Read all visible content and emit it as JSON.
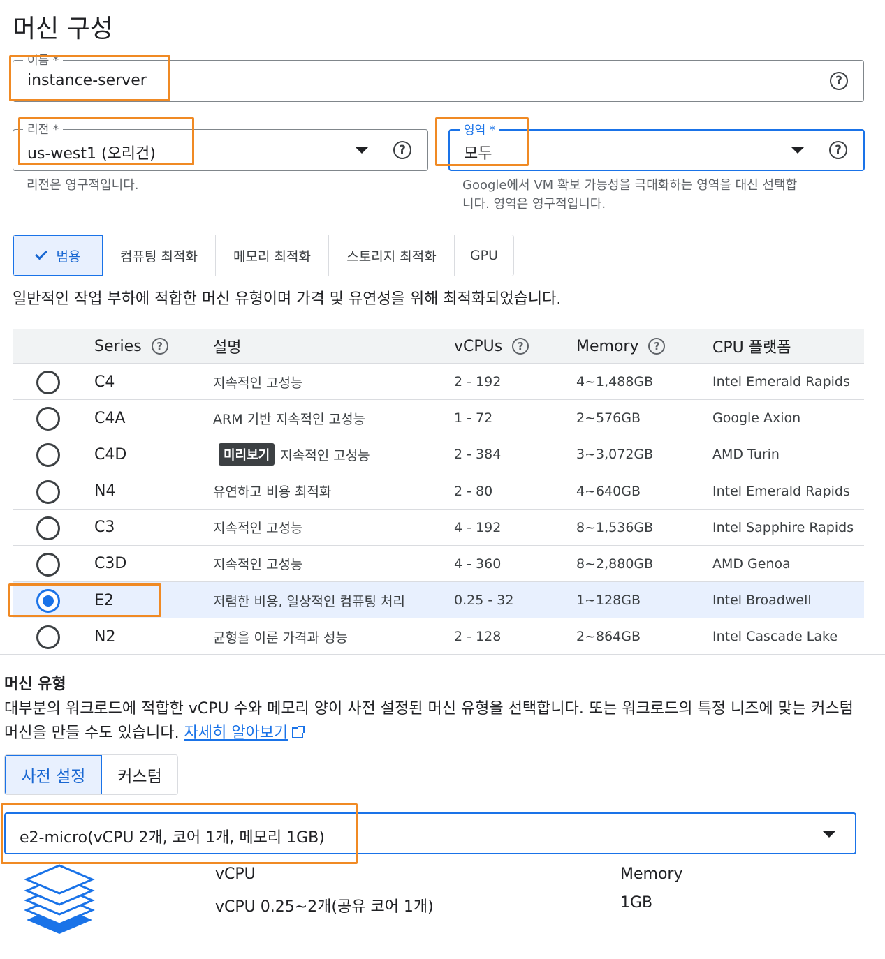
{
  "page_title": "머신 구성",
  "name_field": {
    "label": "이름 *",
    "value": "instance-server"
  },
  "region_field": {
    "label": "리전 *",
    "value": "us-west1 (오리건)",
    "hint": "리전은 영구적입니다."
  },
  "zone_field": {
    "label": "영역 *",
    "value": "모두",
    "hint_line1": "Google에서 VM 확보 가능성을 극대화하는 영역을 대신 선택합",
    "hint_line2": "니다. 영역은 영구적입니다."
  },
  "help_glyph": "?",
  "category_tabs": [
    {
      "label": "범용",
      "active": true
    },
    {
      "label": "컴퓨팅 최적화",
      "active": false
    },
    {
      "label": "메모리 최적화",
      "active": false
    },
    {
      "label": "스토리지 최적화",
      "active": false
    },
    {
      "label": "GPU",
      "active": false
    }
  ],
  "category_description": "일반적인 작업 부하에 적합한 머신 유형이며 가격 및 유연성을 위해 최적화되었습니다.",
  "table": {
    "headers": {
      "series": "Series",
      "description": "설명",
      "vcpus": "vCPUs",
      "memory": "Memory",
      "cpu_platform": "CPU 플랫폼"
    },
    "rows": [
      {
        "series": "C4",
        "description": "지속적인 고성능",
        "vcpus": "2 - 192",
        "memory": "4~1,488GB",
        "cpu_platform": "Intel Emerald Rapids",
        "selected": false
      },
      {
        "series": "C4A",
        "description": "ARM 기반 지속적인 고성능",
        "vcpus": "1 - 72",
        "memory": "2~576GB",
        "cpu_platform": "Google Axion",
        "selected": false
      },
      {
        "series": "C4D",
        "badge": "미리보기",
        "description": "지속적인 고성능",
        "vcpus": "2 - 384",
        "memory": "3~3,072GB",
        "cpu_platform": "AMD Turin",
        "selected": false
      },
      {
        "series": "N4",
        "description": "유연하고 비용 최적화",
        "vcpus": "2 - 80",
        "memory": "4~640GB",
        "cpu_platform": "Intel Emerald Rapids",
        "selected": false
      },
      {
        "series": "C3",
        "description": "지속적인 고성능",
        "vcpus": "4 - 192",
        "memory": "8~1,536GB",
        "cpu_platform": "Intel Sapphire Rapids",
        "selected": false
      },
      {
        "series": "C3D",
        "description": "지속적인 고성능",
        "vcpus": "4 - 360",
        "memory": "8~2,880GB",
        "cpu_platform": "AMD Genoa",
        "selected": false
      },
      {
        "series": "E2",
        "description": "저렴한 비용, 일상적인 컴퓨팅 처리",
        "vcpus": "0.25 - 32",
        "memory": "1~128GB",
        "cpu_platform": "Intel Broadwell",
        "selected": true
      },
      {
        "series": "N2",
        "description": "균형을 이룬 가격과 성능",
        "vcpus": "2 - 128",
        "memory": "2~864GB",
        "cpu_platform": "Intel Cascade Lake",
        "selected": false
      }
    ]
  },
  "machine_type": {
    "title": "머신 유형",
    "description_part1": "대부분의 워크로드에 적합한 vCPU 수와 메모리 양이 사전 설정된 머신 유형을 선택합니다. 또는 워크로드의 특정 니즈에 맞는 커스텀 머신을 만들 수도 있습니다. ",
    "learn_more": "자세히 알아보기",
    "tabs": [
      {
        "label": "사전 설정",
        "active": true
      },
      {
        "label": "커스텀",
        "active": false
      }
    ],
    "selected_value": "e2-micro(vCPU 2개, 코어 1개, 메모리 1GB)",
    "vcpu_label": "vCPU",
    "vcpu_value": "vCPU 0.25~2개(공유 코어 1개)",
    "memory_label": "Memory",
    "memory_value": "1GB"
  },
  "colors": {
    "accent": "#1a73e8",
    "highlight": "#f08a24",
    "selected_row": "#e8f0fe"
  }
}
